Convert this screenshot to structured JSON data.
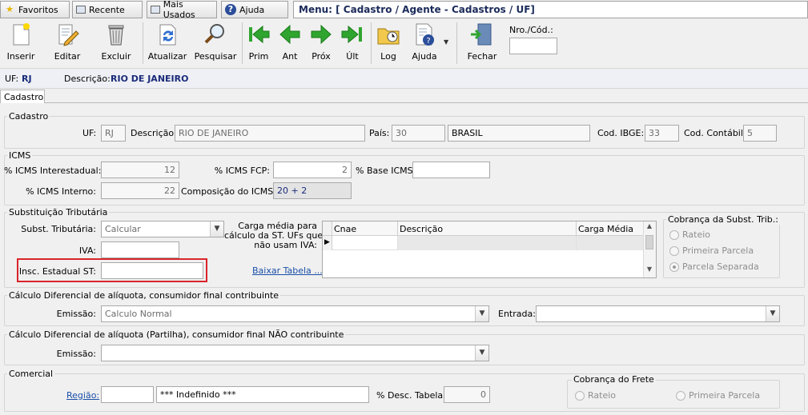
{
  "topbar": {
    "favoritos": "Favoritos",
    "recente": "Recente",
    "mais_usados": "Mais Usados",
    "ajuda": "Ajuda",
    "menu_path": "Menu: [ Cadastro / Agente - Cadastros / UF]"
  },
  "toolbar": {
    "inserir": "Inserir",
    "editar": "Editar",
    "excluir": "Excluir",
    "atualizar": "Atualizar",
    "pesquisar": "Pesquisar",
    "prim": "Prim",
    "ant": "Ant",
    "prox": "Próx",
    "ult": "Últ",
    "log": "Log",
    "ajuda": "Ajuda",
    "fechar": "Fechar",
    "nro_label": "Nro./Cód.:",
    "nro_value": ""
  },
  "infobar": {
    "uf_label": "UF:",
    "uf_value": "RJ",
    "desc_label": "Descrição:",
    "desc_value": "RIO DE JANEIRO"
  },
  "tab": "Cadastro",
  "cadastro": {
    "title": "Cadastro",
    "uf_label": "UF:",
    "uf": "RJ",
    "desc_label": "Descrição:",
    "desc": "RIO DE JANEIRO",
    "pais_label": "País:",
    "pais_code": "30",
    "pais_name": "BRASIL",
    "ibge_label": "Cod. IBGE:",
    "ibge": "33",
    "contabil_label": "Cod. Contábil:",
    "contabil": "5"
  },
  "icms": {
    "title": "ICMS",
    "interestadual_label": "% ICMS Interestadual:",
    "interestadual": "12",
    "fcp_label": "% ICMS FCP:",
    "fcp": "2",
    "base_label": "% Base ICMS:",
    "base": "",
    "interno_label": "% ICMS Interno:",
    "interno": "22",
    "composicao_label": "Composição do ICMS:",
    "composicao": "20 + 2"
  },
  "st": {
    "title": "Substituição Tributária",
    "subst_label": "Subst. Tributária:",
    "subst": "Calcular",
    "iva_label": "IVA:",
    "iva": "",
    "insc_label": "Insc. Estadual ST:",
    "insc": "",
    "carga_label_1": "Carga média para",
    "carga_label_2": "cálculo da ST. UFs que",
    "carga_label_3": "não usam IVA:",
    "baixar": "Baixar Tabela ...",
    "grid_cols": [
      "Cnae",
      "Descrição",
      "Carga Média"
    ],
    "cobranca_title": "Cobrança da Subst. Trib.:",
    "opt_rateio": "Rateio",
    "opt_primeira": "Primeira Parcela",
    "opt_separada": "Parcela Separada"
  },
  "difal1": {
    "title": "Cálculo Diferencial de alíquota, consumidor final contribuinte",
    "emissao_label": "Emissão:",
    "emissao": "Calculo Normal",
    "entrada_label": "Entrada:",
    "entrada": ""
  },
  "difal2": {
    "title": "Cálculo Diferencial de alíquota (Partilha), consumidor final NÃO contribuinte",
    "emissao_label": "Emissão:",
    "emissao": ""
  },
  "comercial": {
    "title": "Comercial",
    "regiao_label": "Região:",
    "regiao_code": "",
    "regiao_name": "*** Indefinido ***",
    "desc_tabela_label": "% Desc. Tabela:",
    "desc_tabela": "0",
    "frete_title": "Cobrança do Frete",
    "frete_rateio": "Rateio",
    "frete_primeira": "Primeira Parcela"
  },
  "colors": {
    "highlight": "#d9252b",
    "link": "#1a4ea8",
    "nav_green": "#2fa52f",
    "info_blue": "#1a2a7a"
  }
}
